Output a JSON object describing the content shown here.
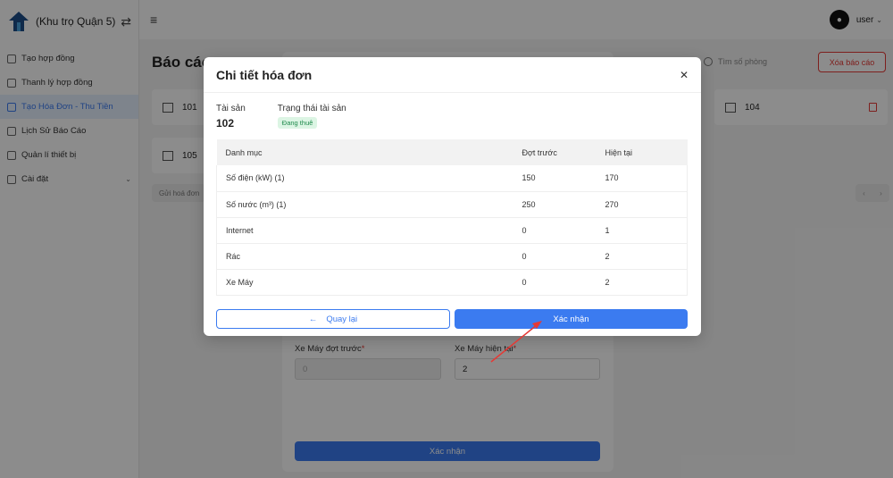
{
  "brand": {
    "name": "(Khu trọ Quận 5)"
  },
  "sidebar": {
    "items": [
      {
        "label": "Tạo hợp đồng"
      },
      {
        "label": "Thanh lý hợp đồng"
      },
      {
        "label": "Tạo Hóa Đơn - Thu Tiền",
        "active": true
      },
      {
        "label": "Lịch Sử Báo Cáo"
      },
      {
        "label": "Quản lí thiết bị"
      },
      {
        "label": "Cài đặt"
      }
    ]
  },
  "header": {
    "user": "user"
  },
  "page": {
    "title": "Báo cáo",
    "search_placeholder": "Tìm số phòng",
    "delete_button": "Xóa báo cáo",
    "rooms": [
      "101",
      "104",
      "105"
    ],
    "send_button": "Gửi hoá đơn"
  },
  "bg_form": {
    "prev_label": "Xe Máy đợt trước",
    "prev_value": "0",
    "curr_label": "Xe Máy hiện tại",
    "curr_value": "2",
    "submit": "Xác nhận"
  },
  "modal": {
    "title": "Chi tiết hóa đơn",
    "asset_label": "Tài sản",
    "asset_value": "102",
    "status_label": "Trạng thái tài sản",
    "status_value": "Đang thuê",
    "table": {
      "headers": [
        "Danh mục",
        "Đợt trước",
        "Hiện tại"
      ],
      "rows": [
        [
          "Số điện (kW) (1)",
          "150",
          "170"
        ],
        [
          "Số nước (m³) (1)",
          "250",
          "270"
        ],
        [
          "Internet",
          "0",
          "1"
        ],
        [
          "Rác",
          "0",
          "2"
        ],
        [
          "Xe Máy",
          "0",
          "2"
        ]
      ]
    },
    "back_button": "Quay lại",
    "confirm_button": "Xác nhận"
  },
  "colors": {
    "accent": "#3b7bf0",
    "danger": "#e53935",
    "status_bg": "#dcf5e4",
    "annotation": "#e53935"
  }
}
